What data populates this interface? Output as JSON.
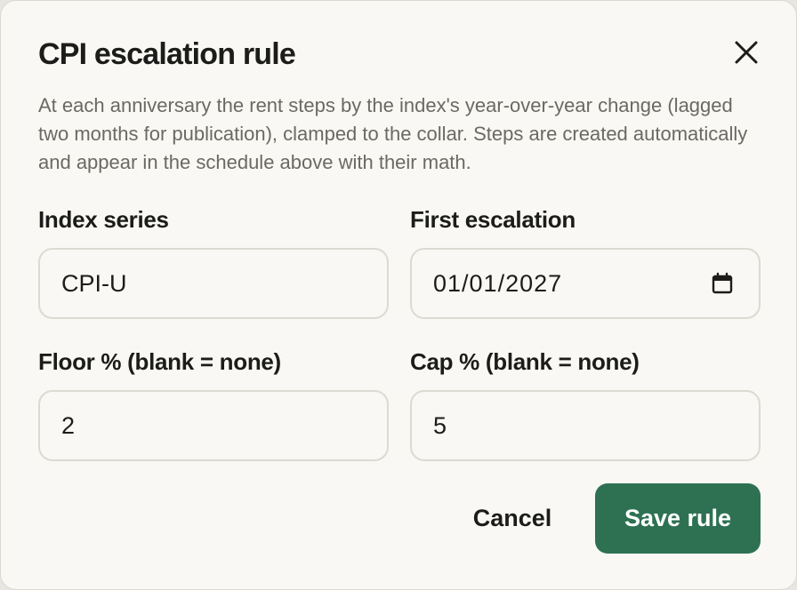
{
  "dialog": {
    "title": "CPI escalation rule",
    "description": "At each anniversary the rent steps by the index's year-over-year change (lagged two months for publication), clamped to the collar. Steps are created automatically and appear in the schedule above with their math.",
    "close_icon": "close-icon"
  },
  "fields": {
    "index_series": {
      "label": "Index series",
      "value": "CPI-U"
    },
    "first_escalation": {
      "label": "First escalation",
      "value": "01/01/2027",
      "icon": "calendar-icon"
    },
    "floor": {
      "label": "Floor % (blank = none)",
      "value": "2"
    },
    "cap": {
      "label": "Cap % (blank = none)",
      "value": "5"
    }
  },
  "actions": {
    "cancel_label": "Cancel",
    "save_label": "Save rule"
  },
  "colors": {
    "primary": "#2e7152",
    "background": "#f9f8f4",
    "muted_text": "#6b6962"
  }
}
